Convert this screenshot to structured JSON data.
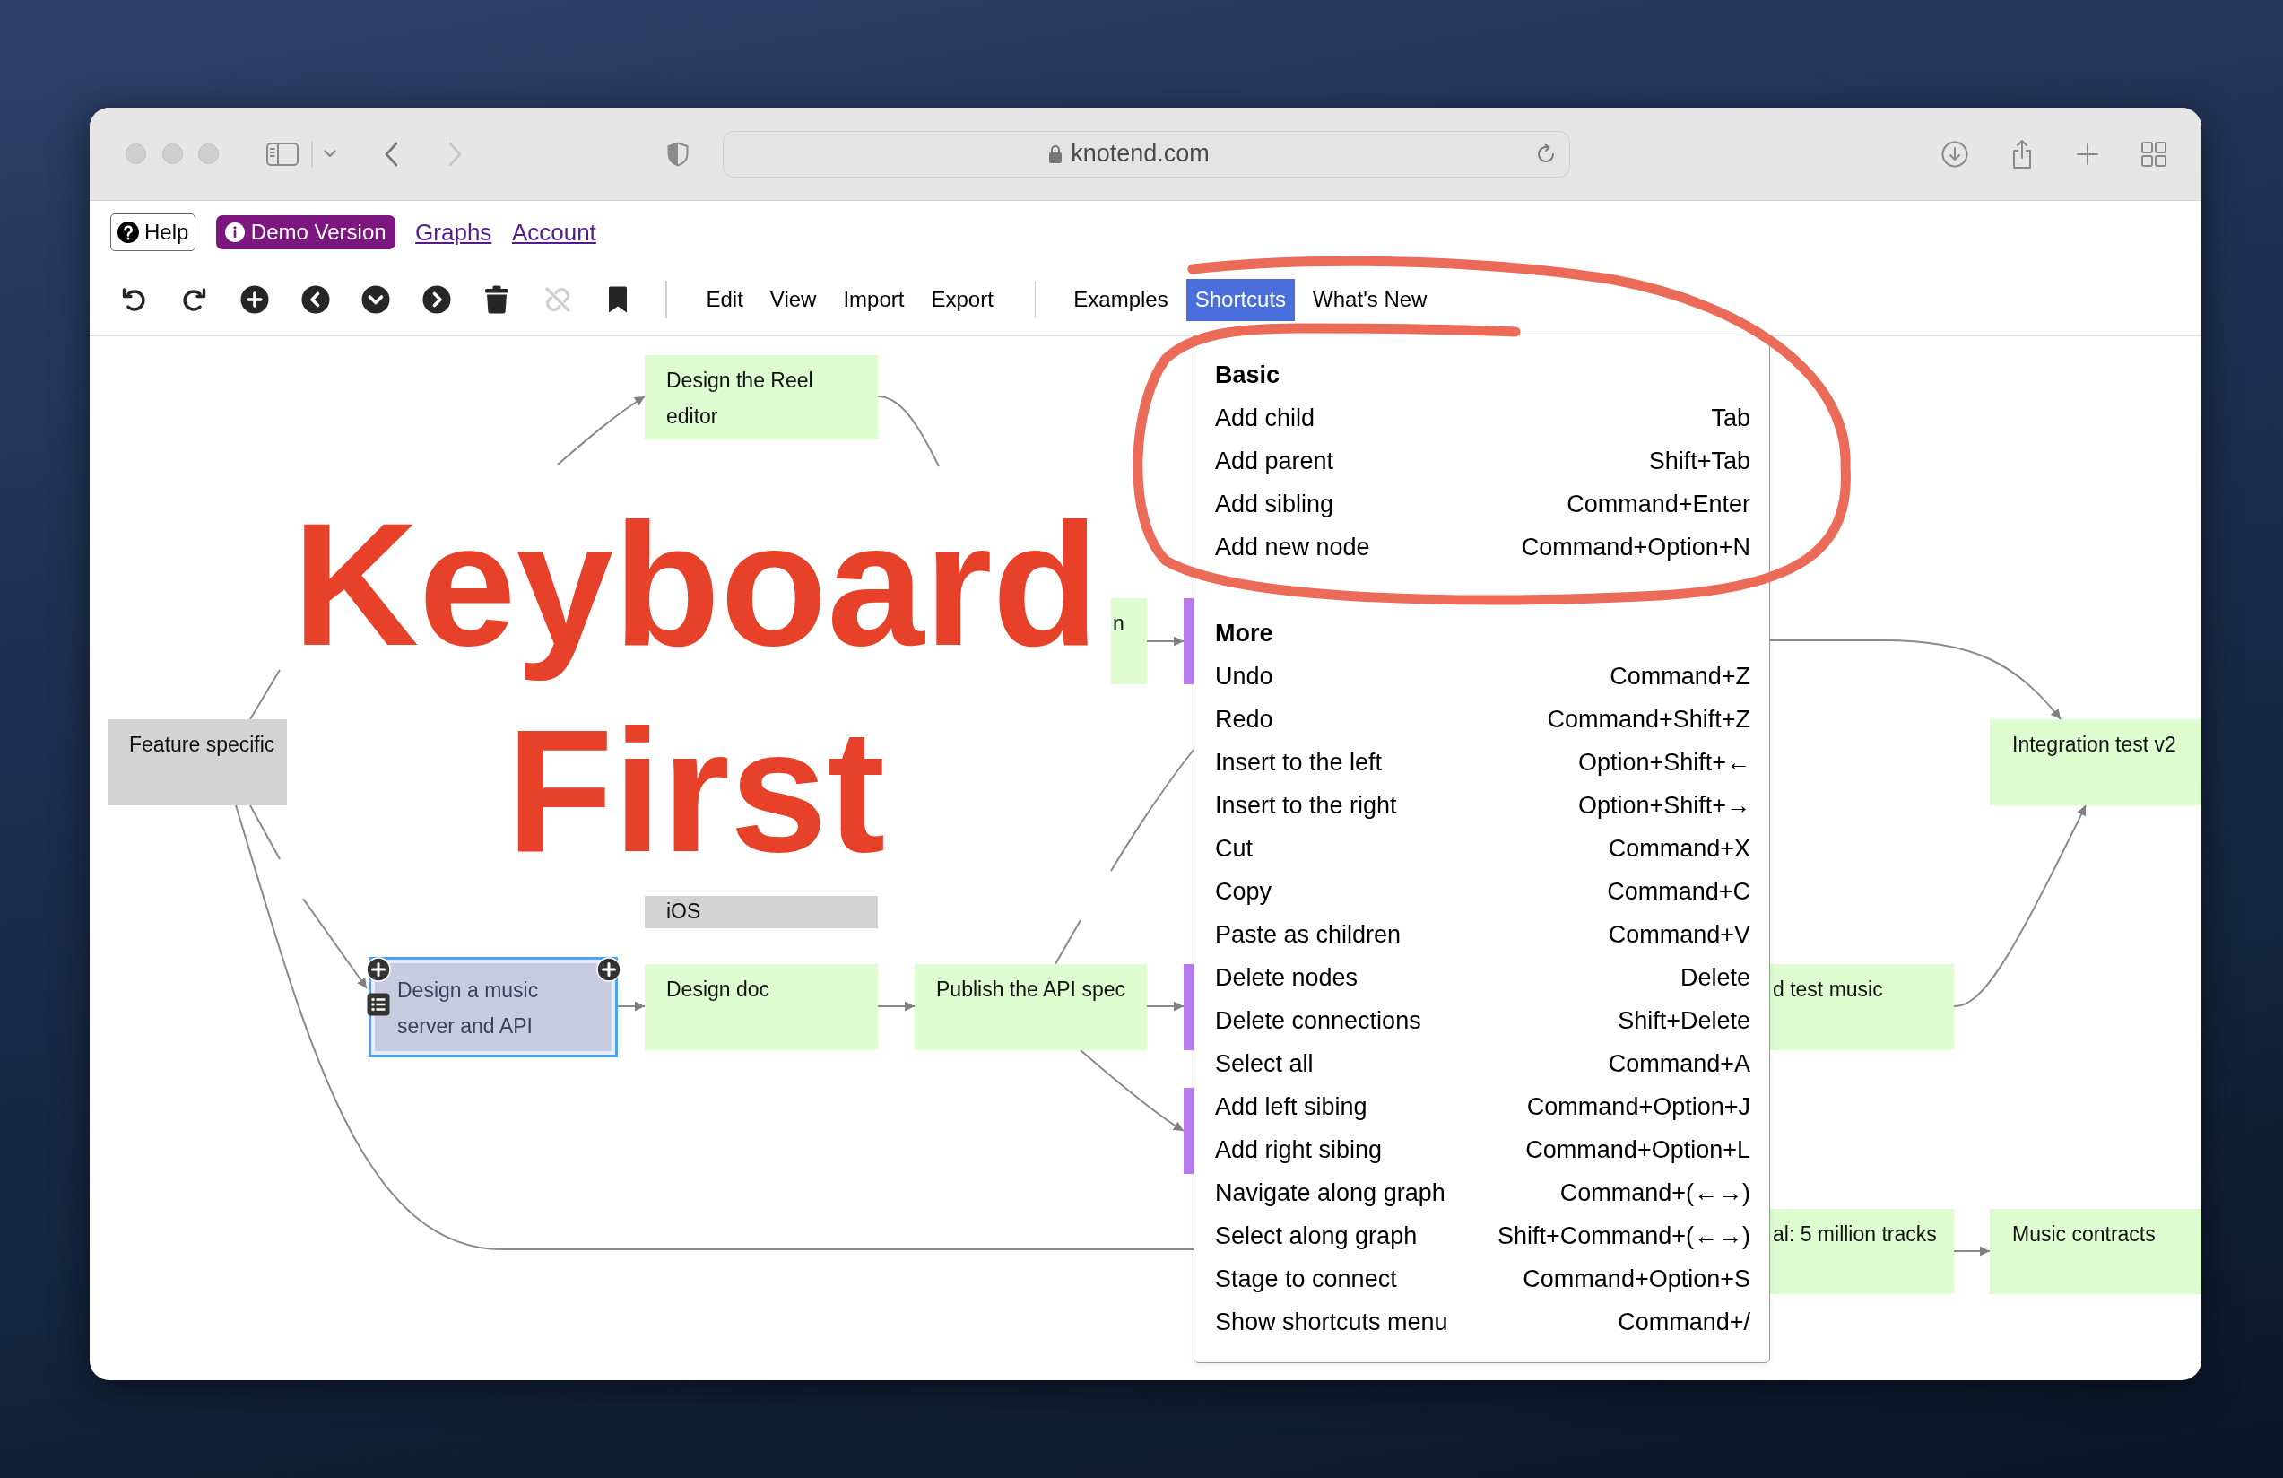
{
  "browser": {
    "nav_buttons": [
      {
        "kind": "back",
        "disabled": false
      },
      {
        "kind": "forward",
        "disabled": true
      }
    ],
    "url": "knotend.com"
  },
  "top_nav": {
    "help_button": "Help",
    "demo_badge": "Demo Version",
    "links": [
      "Graphs",
      "Account"
    ]
  },
  "toolbar": {
    "buttons": [
      {
        "kind": "undo",
        "disabled": false
      },
      {
        "kind": "redo",
        "disabled": false
      },
      {
        "kind": "add",
        "disabled": false
      },
      {
        "kind": "left",
        "disabled": false
      },
      {
        "kind": "down",
        "disabled": false
      },
      {
        "kind": "right",
        "disabled": false
      },
      {
        "kind": "delete",
        "disabled": false
      },
      {
        "kind": "unlink",
        "disabled": true
      },
      {
        "kind": "bookmark",
        "disabled": false
      }
    ],
    "menu_groups": [
      {
        "items": [
          {
            "label": "Edit",
            "selected": false
          },
          {
            "label": "View",
            "selected": false
          },
          {
            "label": "Import",
            "selected": false
          },
          {
            "label": "Export",
            "selected": false
          }
        ]
      },
      {
        "items": [
          {
            "label": "Examples",
            "selected": false
          },
          {
            "label": "Shortcuts",
            "selected": true
          },
          {
            "label": "What's New",
            "selected": false
          }
        ]
      }
    ]
  },
  "headline": "Keyboard First",
  "graph": {
    "nodes": [
      {
        "label": "Design the Reel editor",
        "color": "#ddfdd0",
        "selected": false
      },
      {
        "label": "n",
        "color": "#ddfdd0",
        "selected": false
      },
      {
        "label": "Feature specific",
        "color": "#d3d3d3",
        "selected": false
      },
      {
        "label": "Integration test v2",
        "color": "#ddfdd0",
        "selected": false
      },
      {
        "label": "iOS",
        "color": "#d3d3d3",
        "selected": false
      },
      {
        "label": "Design a music server and API",
        "color": "#c8cce0",
        "selected": true
      },
      {
        "label": "Design doc",
        "color": "#ddfdd0",
        "selected": false
      },
      {
        "label": "Publish the API spec",
        "color": "#ddfdd0",
        "selected": false
      },
      {
        "label": "d test music",
        "color": "#ddfdd0",
        "selected": false
      },
      {
        "label": "al: 5 million tracks",
        "color": "#ddfdd0",
        "selected": false
      },
      {
        "label": "Music contracts",
        "color": "#ddfdd0",
        "selected": false
      },
      {
        "color": "#b87ded",
        "selected": false
      },
      {
        "color": "#b87ded",
        "selected": false
      },
      {
        "color": "#b87ded",
        "selected": false
      }
    ]
  },
  "shortcuts_menu": {
    "sections": [
      {
        "title": "Basic",
        "items": [
          {
            "action": "Add child",
            "keys": "Tab"
          },
          {
            "action": "Add parent",
            "keys": "Shift+Tab"
          },
          {
            "action": "Add sibling",
            "keys": "Command+Enter"
          },
          {
            "action": "Add new node",
            "keys": "Command+Option+N"
          }
        ]
      },
      {
        "title": "More",
        "items": [
          {
            "action": "Undo",
            "keys": "Command+Z"
          },
          {
            "action": "Redo",
            "keys": "Command+Shift+Z"
          },
          {
            "action": "Insert to the left",
            "keys": "Option+Shift+←"
          },
          {
            "action": "Insert to the right",
            "keys": "Option+Shift+→"
          },
          {
            "action": "Cut",
            "keys": "Command+X"
          },
          {
            "action": "Copy",
            "keys": "Command+C"
          },
          {
            "action": "Paste as children",
            "keys": "Command+V"
          },
          {
            "action": "Delete nodes",
            "keys": "Delete"
          },
          {
            "action": "Delete connections",
            "keys": "Shift+Delete"
          },
          {
            "action": "Select all",
            "keys": "Command+A"
          },
          {
            "action": "Add left sibing",
            "keys": "Command+Option+J"
          },
          {
            "action": "Add right sibing",
            "keys": "Command+Option+L"
          },
          {
            "action": "Navigate along graph",
            "keys": "Command+(←→)"
          },
          {
            "action": "Select along graph",
            "keys": "Shift+Command+(←→)"
          },
          {
            "action": "Stage to connect",
            "keys": "Command+Option+S"
          },
          {
            "action": "Show shortcuts menu",
            "keys": "Command+/"
          }
        ]
      }
    ]
  }
}
